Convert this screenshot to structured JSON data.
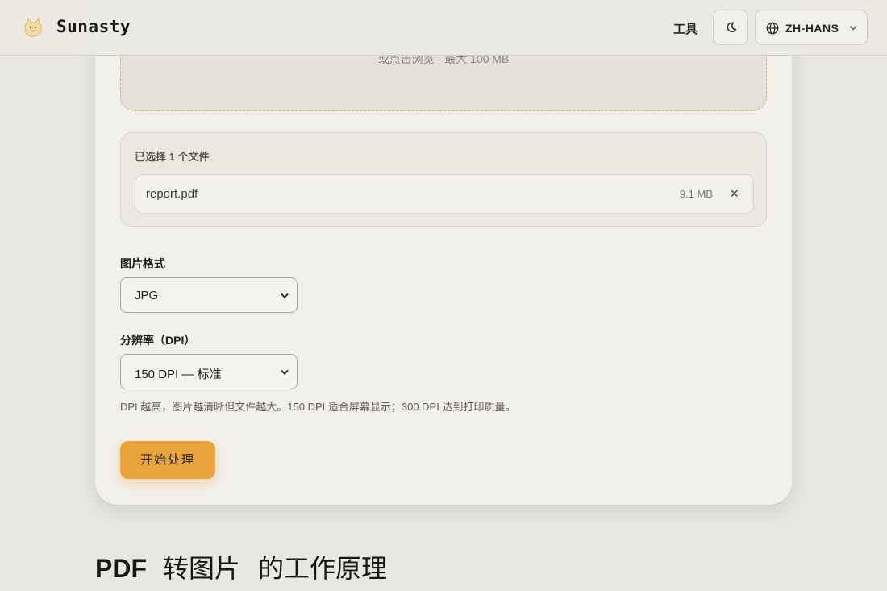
{
  "header": {
    "brand": "Sunasty",
    "nav_tools": "工具",
    "language": "ZH-HANS"
  },
  "upload": {
    "hint": "或点击浏览 · 最大 100 MB"
  },
  "files": {
    "title": "已选择 1 个文件",
    "items": [
      {
        "name": "report.pdf",
        "size": "9.1 MB",
        "remove": "×"
      }
    ]
  },
  "format": {
    "label": "图片格式",
    "value": "JPG"
  },
  "dpi": {
    "label": "分辨率（DPI）",
    "value": "150 DPI — 标准",
    "help": "DPI 越高，图片越清晰但文件越大。150 DPI 适合屏幕显示；300 DPI 达到打印质量。"
  },
  "actions": {
    "start": "开始处理"
  },
  "section": {
    "title_part1": "PDF",
    "title_part2": "转图片",
    "title_part3": "的工作原理"
  },
  "colors": {
    "accent": "#e9a43c",
    "dropzone_border": "#e2b46a",
    "background": "#e9e7e2"
  },
  "icons": {
    "logo": "cat-logo-icon",
    "theme": "moon-icon",
    "language": "globe-icon",
    "dropdown": "chevron-down-icon",
    "remove": "close-icon"
  }
}
